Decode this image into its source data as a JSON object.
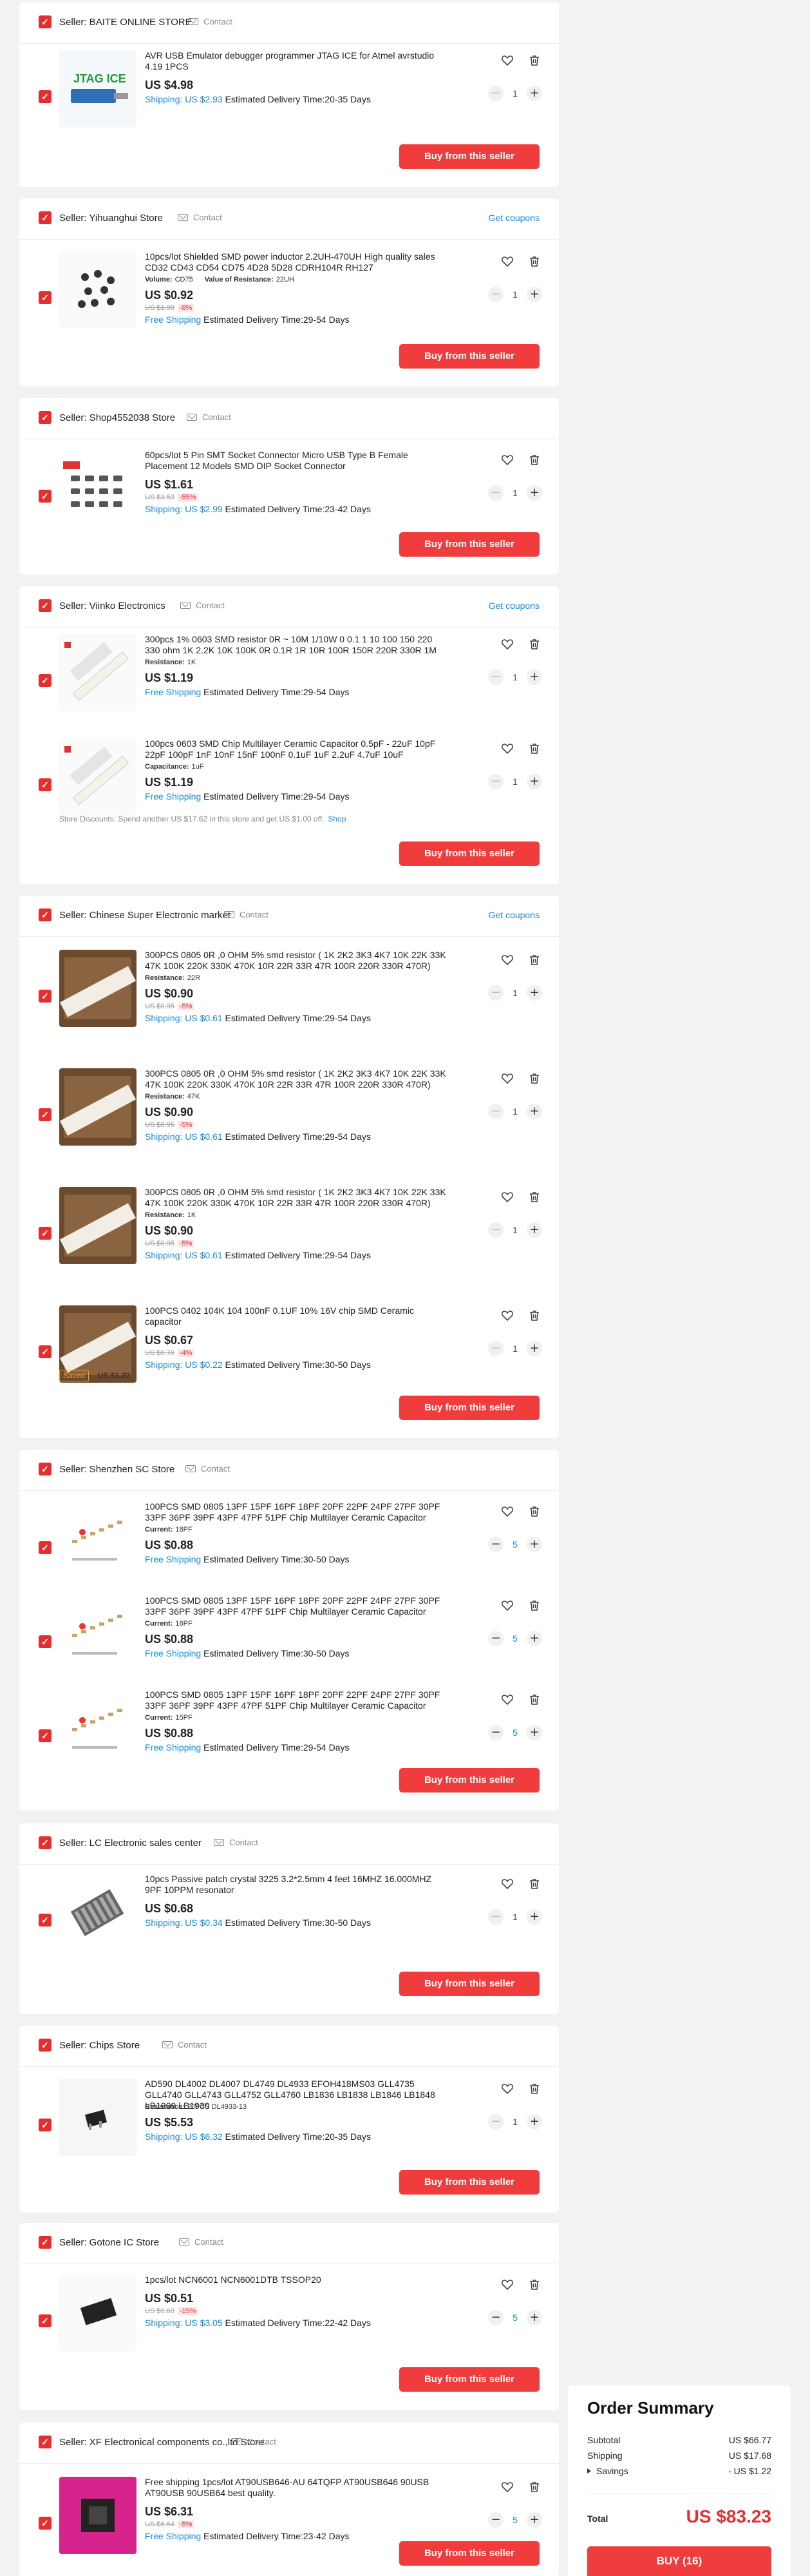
{
  "common": {
    "contact_label": "Contact",
    "buy_label": "Buy from this seller",
    "coupons_label": "Get coupons",
    "checkbox_mark": "✓",
    "minus": "−",
    "plus": "+"
  },
  "stores": [
    {
      "seller": "Seller: BAITE ONLINE STORE",
      "coupons": false,
      "items": [
        {
          "title": "AVR USB Emulator debugger programmer JTAG ICE for Atmel avrstudio 4.19 1PCS",
          "attrs": [],
          "price": "US $4.98",
          "orig": "",
          "discount": "",
          "shipping_cost": "Shipping: US $2.93",
          "delivery": " Estimated Delivery Time:20-35 Days",
          "qty": "1",
          "qty_active": false,
          "thumb": "jtag"
        }
      ]
    },
    {
      "seller": "Seller: Yihuanghui Store",
      "coupons": true,
      "items": [
        {
          "title": "10pcs/lot Shielded SMD power inductor 2.2UH-470UH High quality sales CD32 CD43 CD54 CD75 4D28 5D28 CDRH104R RH127",
          "attrs": [
            {
              "k": "Volume:",
              "v": "CD75"
            },
            {
              "k": "Value of Resistance:",
              "v": "22UH"
            }
          ],
          "price": "US $0.92",
          "orig": "US $1.00",
          "discount": "-8%",
          "shipping_cost": "Free Shipping",
          "delivery": " Estimated Delivery Time:29-54 Days",
          "qty": "1",
          "qty_active": false,
          "thumb": "inductor"
        }
      ]
    },
    {
      "seller": "Seller: Shop4552038 Store",
      "coupons": false,
      "items": [
        {
          "title": "60pcs/lot 5 Pin SMT Socket Connector Micro USB Type B Female Placement 12 Models SMD DIP Socket Connector",
          "attrs": [],
          "price": "US $1.61",
          "orig": "US $3.53",
          "discount": "-55%",
          "shipping_cost": "Shipping: US $2.99",
          "delivery": " Estimated Delivery Time:23-42 Days",
          "qty": "1",
          "qty_active": false,
          "thumb": "usb"
        }
      ]
    },
    {
      "seller": "Seller: Viinko Electronics",
      "coupons": true,
      "discount_note": "Store Discounts: Spend another US $17.62 in this store and get US $1.00 off.",
      "discount_link": "Shop",
      "items": [
        {
          "title": "300pcs 1% 0603 SMD resistor 0R ~ 10M 1/10W 0 0.1 1 10 100 150 220 330 ohm 1K 2.2K 10K 100K 0R 0.1R 1R 10R 100R 150R 220R 330R 1M",
          "attrs": [
            {
              "k": "Resistance:",
              "v": "1K"
            }
          ],
          "price": "US $1.19",
          "orig": "",
          "discount": "",
          "shipping_cost": "Free Shipping",
          "delivery": " Estimated Delivery Time:29-54 Days",
          "qty": "1",
          "qty_active": false,
          "thumb": "tape"
        },
        {
          "title": "100pcs 0603 SMD Chip Multilayer Ceramic Capacitor 0.5pF - 22uF 10pF 22pF 100pF 1nF 10nF 15nF 100nF 0.1uF 1uF 2.2uF 4.7uF 10uF",
          "attrs": [
            {
              "k": "Capacitance:",
              "v": "1uF"
            }
          ],
          "price": "US $1.19",
          "orig": "",
          "discount": "",
          "shipping_cost": "Free Shipping",
          "delivery": " Estimated Delivery Time:29-54 Days",
          "qty": "1",
          "qty_active": false,
          "thumb": "tape"
        }
      ]
    },
    {
      "seller": "Seller: Chinese Super Electronic market",
      "coupons": true,
      "saved_tag": "Saved",
      "saved_value": "US $1.22",
      "items": [
        {
          "title": "300PCS 0805 0R ,0 OHM 5% smd resistor ( 1K 2K2 3K3 4K7 10K 22K 33K 47K 100K 220K 330K 470K 10R 22R 33R 47R 100R 220R 330R 470R)",
          "attrs": [
            {
              "k": "Resistance:",
              "v": "22R"
            }
          ],
          "price": "US $0.90",
          "orig": "US $0.95",
          "discount": "-5%",
          "shipping_cost": "Shipping: US $0.61",
          "delivery": " Estimated Delivery Time:29-54 Days",
          "qty": "1",
          "qty_active": false,
          "thumb": "reel"
        },
        {
          "title": "300PCS 0805 0R ,0 OHM 5% smd resistor ( 1K 2K2 3K3 4K7 10K 22K 33K 47K 100K 220K 330K 470K 10R 22R 33R 47R 100R 220R 330R 470R)",
          "attrs": [
            {
              "k": "Resistance:",
              "v": "47K"
            }
          ],
          "price": "US $0.90",
          "orig": "US $0.95",
          "discount": "-5%",
          "shipping_cost": "Shipping: US $0.61",
          "delivery": " Estimated Delivery Time:29-54 Days",
          "qty": "1",
          "qty_active": false,
          "thumb": "reel"
        },
        {
          "title": "300PCS 0805 0R ,0 OHM 5% smd resistor ( 1K 2K2 3K3 4K7 10K 22K 33K 47K 100K 220K 330K 470K 10R 22R 33R 47R 100R 220R 330R 470R)",
          "attrs": [
            {
              "k": "Resistance:",
              "v": "1K"
            }
          ],
          "price": "US $0.90",
          "orig": "US $0.95",
          "discount": "-5%",
          "shipping_cost": "Shipping: US $0.61",
          "delivery": " Estimated Delivery Time:29-54 Days",
          "qty": "1",
          "qty_active": false,
          "thumb": "reel"
        },
        {
          "title": "100PCS 0402 104K 104 100nF 0.1UF 10% 16V chip SMD Ceramic capacitor",
          "attrs": [],
          "price": "US $0.67",
          "orig": "US $0.70",
          "discount": "-4%",
          "shipping_cost": "Shipping: US $0.22",
          "delivery": " Estimated Delivery Time:30-50 Days",
          "qty": "1",
          "qty_active": false,
          "thumb": "reel"
        }
      ]
    },
    {
      "seller": "Seller: Shenzhen SC Store",
      "coupons": false,
      "items": [
        {
          "title": "100PCS SMD 0805 13PF 15PF 16PF 18PF 20PF 22PF 24PF 27PF 30PF 33PF 36PF 39PF 43PF 47PF 51PF Chip Multilayer Ceramic Capacitor",
          "attrs": [
            {
              "k": "Current:",
              "v": "18PF"
            }
          ],
          "price": "US $0.88",
          "orig": "",
          "discount": "",
          "shipping_cost": "Free Shipping",
          "delivery": " Estimated Delivery Time:30-50 Days",
          "qty": "5",
          "qty_active": true,
          "thumb": "capstrip"
        },
        {
          "title": "100PCS SMD 0805 13PF 15PF 16PF 18PF 20PF 22PF 24PF 27PF 30PF 33PF 36PF 39PF 43PF 47PF 51PF Chip Multilayer Ceramic Capacitor",
          "attrs": [
            {
              "k": "Current:",
              "v": "16PF"
            }
          ],
          "price": "US $0.88",
          "orig": "",
          "discount": "",
          "shipping_cost": "Free Shipping",
          "delivery": " Estimated Delivery Time:30-50 Days",
          "qty": "5",
          "qty_active": true,
          "thumb": "capstrip"
        },
        {
          "title": "100PCS SMD 0805 13PF 15PF 16PF 18PF 20PF 22PF 24PF 27PF 30PF 33PF 36PF 39PF 43PF 47PF 51PF Chip Multilayer Ceramic Capacitor",
          "attrs": [
            {
              "k": "Current:",
              "v": "15PF"
            }
          ],
          "price": "US $0.88",
          "orig": "",
          "discount": "",
          "shipping_cost": "Free Shipping",
          "delivery": " Estimated Delivery Time:29-54 Days",
          "qty": "5",
          "qty_active": true,
          "thumb": "capstrip"
        }
      ]
    },
    {
      "seller": "Seller: LC Electronic sales center",
      "coupons": false,
      "items": [
        {
          "title": "10pcs Passive patch crystal 3225 3.2*2.5mm 4 feet 16MHZ 16.000MHZ 9PF 10PPM resonator",
          "attrs": [],
          "price": "US $0.68",
          "orig": "",
          "discount": "",
          "shipping_cost": "Shipping: US $0.34",
          "delivery": " Estimated Delivery Time:30-50 Days",
          "qty": "1",
          "qty_active": false,
          "thumb": "crystal"
        }
      ]
    },
    {
      "seller": "Seller: Chips Store",
      "coupons": false,
      "items": [
        {
          "title": "AD590 DL4002 DL4007 DL4749 DL4933 EFOH418MS03 GLL4735 GLL4740 GLL4743 GLL4752 GLL4760 LB1836 LB1838 LB1846 LB1848 LB1909 LB1930",
          "attrs": [
            {
              "k": "Resistance:",
              "v": "20PCS DL4933-13"
            }
          ],
          "price": "US $5.53",
          "orig": "",
          "discount": "",
          "shipping_cost": "Shipping: US $6.32",
          "delivery": " Estimated Delivery Time:20-35 Days",
          "qty": "1",
          "qty_active": false,
          "thumb": "chip"
        }
      ]
    },
    {
      "seller": "Seller: Gotone IC Store",
      "coupons": false,
      "items": [
        {
          "title": "1pcs/lot NCN6001 NCN6001DTB TSSOP20",
          "attrs": [],
          "price": "US $0.51",
          "orig": "US $0.60",
          "discount": "-15%",
          "shipping_cost": "Shipping: US $3.05",
          "delivery": " Estimated Delivery Time:22-42 Days",
          "qty": "5",
          "qty_active": true,
          "thumb": "tssop"
        }
      ]
    },
    {
      "seller": "Seller: XF Electronical components co.,ltd Store",
      "coupons": false,
      "items": [
        {
          "title": "Free shipping 1pcs/lot AT90USB646-AU 64TQFP AT90USB646 90USB AT90USB 90USB64 best quality.",
          "attrs": [],
          "price": "US $6.31",
          "orig": "US $6.64",
          "discount": "-5%",
          "shipping_cost": "Free Shipping",
          "delivery": " Estimated Delivery Time:23-42 Days",
          "qty": "5",
          "qty_active": true,
          "thumb": "pink"
        }
      ]
    }
  ],
  "summary": {
    "title": "Order Summary",
    "subtotal_label": "Subtotal",
    "subtotal": "US $66.77",
    "shipping_label": "Shipping",
    "shipping": "US $17.68",
    "savings_label": "Savings",
    "savings": "- US $1.22",
    "total_label": "Total",
    "total": "US $83.23",
    "buy_label": "BUY (16)"
  }
}
